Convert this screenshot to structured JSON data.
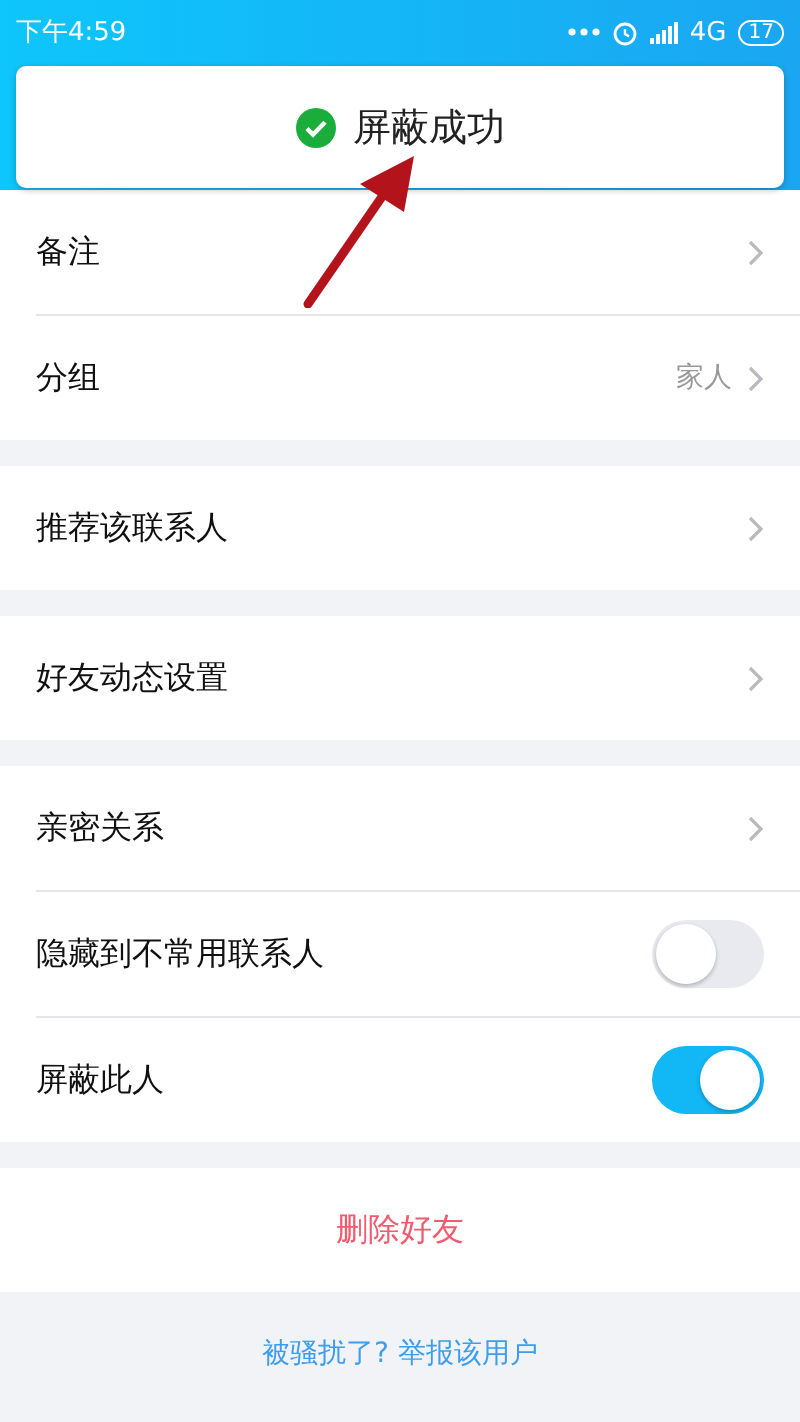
{
  "status_bar": {
    "time": "下午4:59",
    "network": "4G",
    "battery": "17"
  },
  "toast": {
    "text": "屏蔽成功"
  },
  "sections": [
    {
      "items": [
        {
          "kind": "link",
          "label": "备注"
        },
        {
          "kind": "link",
          "label": "分组",
          "value": "家人"
        }
      ]
    },
    {
      "items": [
        {
          "kind": "link",
          "label": "推荐该联系人"
        }
      ]
    },
    {
      "items": [
        {
          "kind": "link",
          "label": "好友动态设置"
        }
      ]
    },
    {
      "items": [
        {
          "kind": "link",
          "label": "亲密关系"
        },
        {
          "kind": "toggle",
          "label": "隐藏到不常用联系人",
          "on": false
        },
        {
          "kind": "toggle",
          "label": "屏蔽此人",
          "on": true
        }
      ]
    }
  ],
  "delete_button": "删除好友",
  "report_link": "被骚扰了? 举报该用户"
}
